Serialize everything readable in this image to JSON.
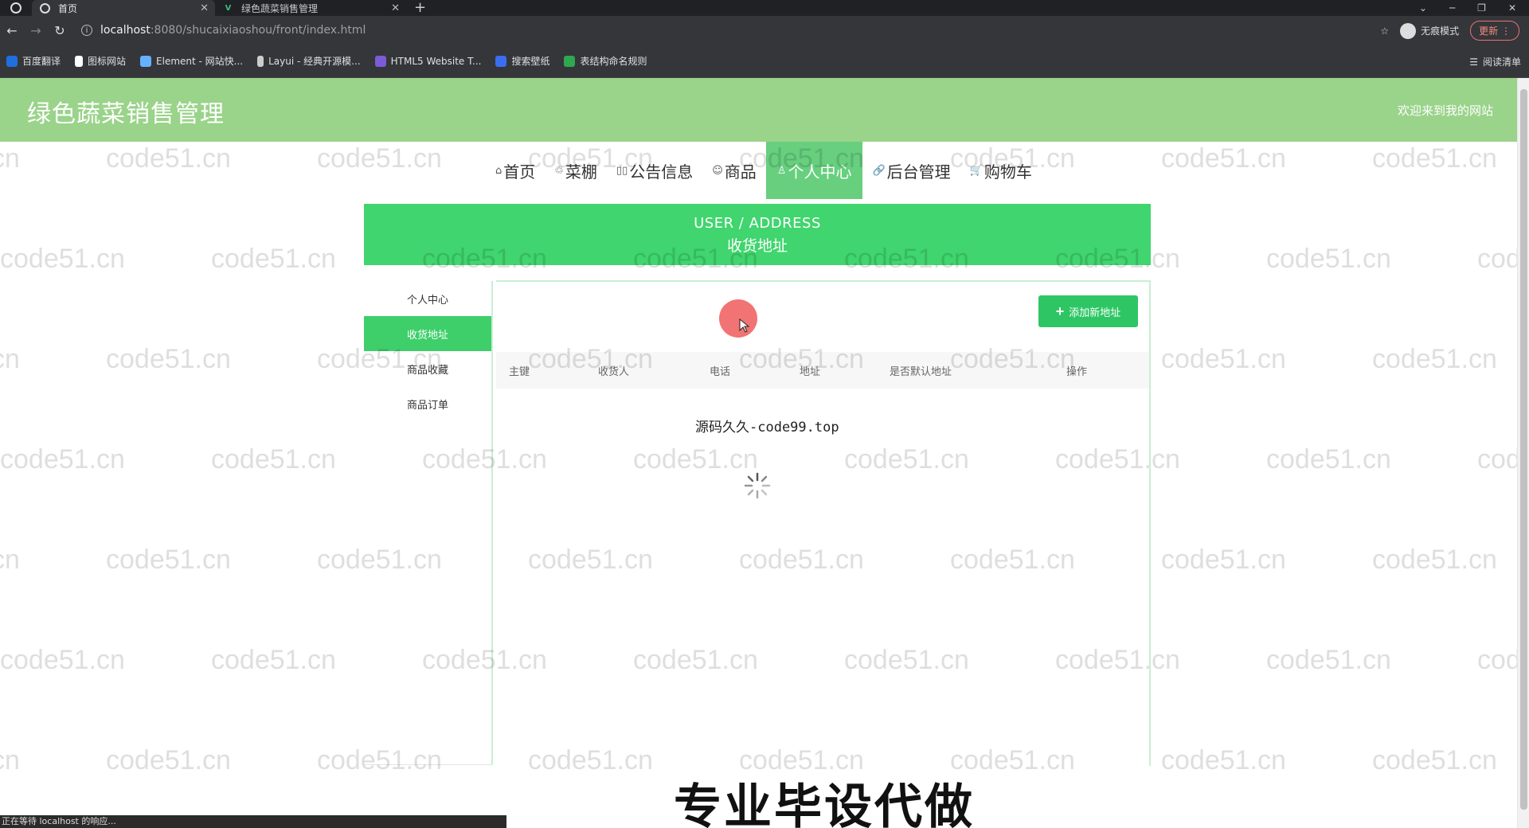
{
  "browser": {
    "tabs": [
      {
        "title": "首页",
        "active": true
      },
      {
        "title": "绿色蔬菜销售管理",
        "active": false
      }
    ],
    "url_host": "localhost",
    "url_path": ":8080/shucaixiaoshou/front/index.html",
    "incognito_label": "无痕模式",
    "update_label": "更新",
    "bookmarks": [
      {
        "label": "百度翻译",
        "color": "#1e6fe0"
      },
      {
        "label": "图标网站",
        "color": "#ffffff"
      },
      {
        "label": "Element - 网站快...",
        "color": "#66b1ff"
      },
      {
        "label": "Layui - 经典开源模...",
        "color": "#cccccc"
      },
      {
        "label": "HTML5 Website T...",
        "color": "#7b5cd6"
      },
      {
        "label": "搜索壁纸",
        "color": "#3a6df0"
      },
      {
        "label": "表结构命名规则",
        "color": "#2fa84f"
      }
    ],
    "reading_list": "阅读清单",
    "status_text": "正在等待 localhost 的响应..."
  },
  "site": {
    "title": "绿色蔬菜销售管理",
    "welcome": "欢迎来到我的网站",
    "nav": [
      {
        "label": "首页",
        "icon": "⌂",
        "active": false
      },
      {
        "label": "菜棚",
        "icon": "♲",
        "active": false
      },
      {
        "label": "公告信息",
        "icon": "▯▯",
        "active": false
      },
      {
        "label": "商品",
        "icon": "☺",
        "active": false
      },
      {
        "label": "个人中心",
        "icon": "♙",
        "active": true
      },
      {
        "label": "后台管理",
        "icon": "🔗",
        "active": false
      },
      {
        "label": "购物车",
        "icon": "🛒",
        "active": false
      }
    ],
    "banner_en": "USER / ADDRESS",
    "banner_cn": "收货地址",
    "sidebar": [
      {
        "label": "个人中心",
        "active": false
      },
      {
        "label": "收货地址",
        "active": true
      },
      {
        "label": "商品收藏",
        "active": false
      },
      {
        "label": "商品订单",
        "active": false
      }
    ],
    "add_button": "添加新地址",
    "table_headers": [
      "主键",
      "收货人",
      "电话",
      "地址",
      "是否默认地址",
      "操作"
    ],
    "loading_text": "源码久久-code99.top",
    "accent_color": "#40d56e"
  },
  "overlay": {
    "watermark": "code51.cn",
    "caption": "专业毕设代做"
  }
}
